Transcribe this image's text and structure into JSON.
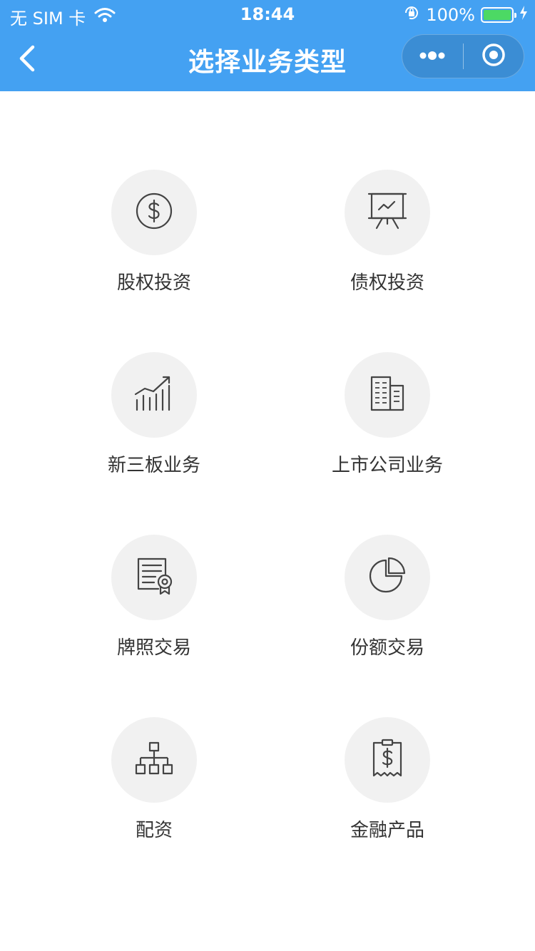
{
  "status_bar": {
    "carrier": "无 SIM 卡",
    "time": "18:44",
    "battery": "100%"
  },
  "nav": {
    "title": "选择业务类型",
    "back_icon": "chevron-left-icon",
    "more_icon": "more-dots-icon",
    "close_icon": "target-circle-icon"
  },
  "business_types": [
    {
      "label": "股权投资",
      "icon": "dollar-coin-icon"
    },
    {
      "label": "债权投资",
      "icon": "presentation-board-icon"
    },
    {
      "label": "新三板业务",
      "icon": "growth-chart-icon"
    },
    {
      "label": "上市公司业务",
      "icon": "office-building-icon"
    },
    {
      "label": "牌照交易",
      "icon": "license-certificate-icon"
    },
    {
      "label": "份额交易",
      "icon": "pie-chart-icon"
    },
    {
      "label": "配资",
      "icon": "org-hierarchy-icon"
    },
    {
      "label": "金融产品",
      "icon": "dollar-receipt-icon"
    }
  ],
  "colors": {
    "header": "#44a1f2",
    "icon_circle": "#f1f1f1",
    "icon_stroke": "#444444",
    "label_text": "#333333",
    "battery_fill": "#4cd964"
  }
}
